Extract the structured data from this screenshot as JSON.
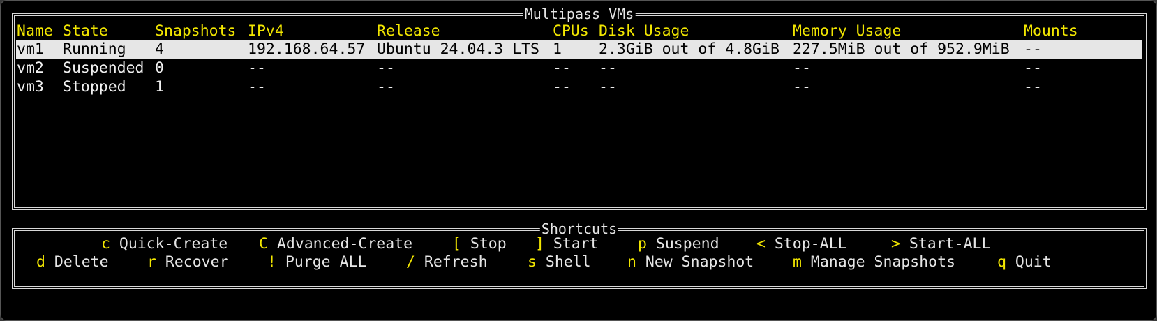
{
  "vm_panel": {
    "title": "Multipass VMs",
    "columns": [
      "Name",
      "State",
      "Snapshots",
      "IPv4",
      "Release",
      "CPUs",
      "Disk Usage",
      "Memory Usage",
      "Mounts"
    ],
    "rows": [
      {
        "name": "vm1",
        "state": "Running",
        "snapshots": "4",
        "ipv4": "192.168.64.57",
        "release": "Ubuntu 24.04.3 LTS",
        "cpus": "1",
        "disk": "2.3GiB out of 4.8GiB",
        "memory": "227.5MiB out of 952.9MiB",
        "mounts": "--",
        "selected": true
      },
      {
        "name": "vm2",
        "state": "Suspended",
        "snapshots": "0",
        "ipv4": "--",
        "release": "--",
        "cpus": "--",
        "disk": "--",
        "memory": "--",
        "mounts": "--",
        "selected": false
      },
      {
        "name": "vm3",
        "state": "Stopped",
        "snapshots": "1",
        "ipv4": "--",
        "release": "--",
        "cpus": "--",
        "disk": "--",
        "memory": "--",
        "mounts": "--",
        "selected": false
      }
    ]
  },
  "shortcuts": {
    "title": "Shortcuts",
    "row1": [
      {
        "key": "c",
        "label": "Quick-Create"
      },
      {
        "key": "C",
        "label": "Advanced-Create"
      },
      {
        "key": "[",
        "label": "Stop"
      },
      {
        "key": "]",
        "label": "Start"
      },
      {
        "key": "p",
        "label": "Suspend"
      },
      {
        "key": "<",
        "label": "Stop-ALL"
      },
      {
        "key": ">",
        "label": "Start-ALL"
      }
    ],
    "row2": [
      {
        "key": "d",
        "label": "Delete"
      },
      {
        "key": "r",
        "label": "Recover"
      },
      {
        "key": "!",
        "label": "Purge ALL"
      },
      {
        "key": "/",
        "label": "Refresh"
      },
      {
        "key": "s",
        "label": "Shell"
      },
      {
        "key": "n",
        "label": "New Snapshot"
      },
      {
        "key": "m",
        "label": "Manage Snapshots"
      },
      {
        "key": "q",
        "label": "Quit"
      }
    ]
  },
  "colors": {
    "accent": "#f2e600",
    "text": "#f0f0f0",
    "selection": "#e6e6e6",
    "background": "#000000"
  }
}
